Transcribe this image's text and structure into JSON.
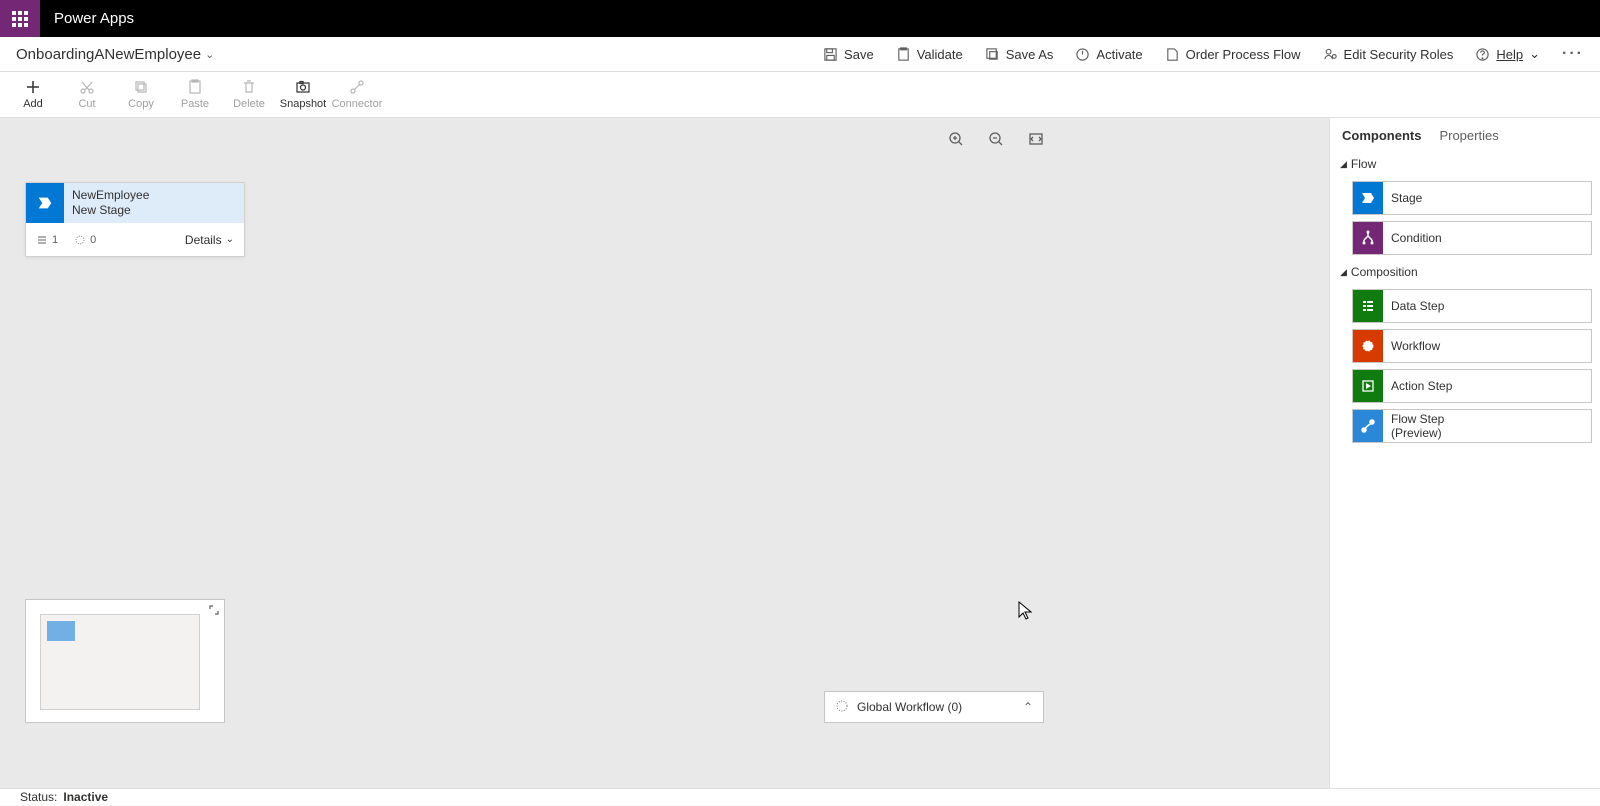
{
  "app_name": "Power Apps",
  "flow_name": "OnboardingANewEmployee",
  "commands": {
    "save": "Save",
    "validate": "Validate",
    "saveas": "Save As",
    "activate": "Activate",
    "order": "Order Process Flow",
    "security": "Edit Security Roles",
    "help": "Help"
  },
  "tools": {
    "add": "Add",
    "cut": "Cut",
    "copy": "Copy",
    "paste": "Paste",
    "delete": "Delete",
    "snapshot": "Snapshot",
    "connector": "Connector"
  },
  "stage": {
    "entity": "NewEmployee",
    "name": "New Stage",
    "steps": "1",
    "workflows": "0",
    "details": "Details"
  },
  "global_workflow": "Global Workflow (0)",
  "panel": {
    "tab_components": "Components",
    "tab_properties": "Properties",
    "group_flow": "Flow",
    "group_composition": "Composition",
    "items": {
      "stage": "Stage",
      "condition": "Condition",
      "datastep": "Data Step",
      "workflow": "Workflow",
      "actionstep": "Action Step",
      "flowstep_l1": "Flow Step",
      "flowstep_l2": "(Preview)"
    }
  },
  "status": {
    "label": "Status:",
    "value": "Inactive"
  }
}
